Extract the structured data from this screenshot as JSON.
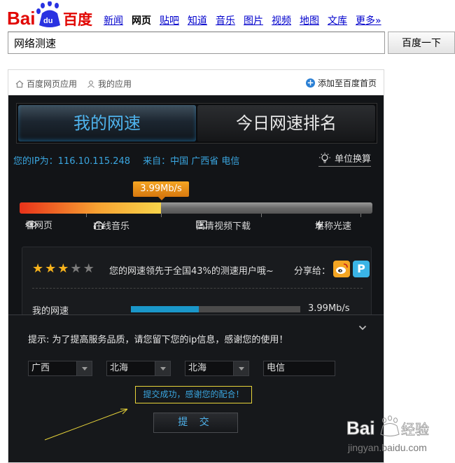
{
  "logo": {
    "bai": "Bai",
    "du": "du",
    "cn": "百度"
  },
  "nav": {
    "items": [
      "新闻",
      "网页",
      "贴吧",
      "知道",
      "音乐",
      "图片",
      "视频",
      "地图",
      "文库"
    ],
    "active_index": 1,
    "more": "更多»"
  },
  "search": {
    "value": "网络测速",
    "button": "百度一下"
  },
  "app": {
    "crumb_home": "百度网页应用",
    "crumb_mine": "我的应用",
    "add_home": "添加至百度首页",
    "tab_my": "我的网速",
    "tab_rank": "今日网速排名",
    "ip_label": "您的IP为：116.10.115.248",
    "from_label": "来自：中国 广西省 电信",
    "unit_switch": "单位换算",
    "speed_tip": "3.99Mb/s",
    "speed_fraction": 0.4,
    "scale_labels": [
      "看网页",
      "在线音乐",
      "高清视频下载",
      "堪称光速"
    ],
    "stars_on": 3,
    "stars_total": 5,
    "rank_text": "您的网速领先于全国43%的测速用户哦~",
    "share_label": "分享给：",
    "my_speed_label": "我的网速",
    "my_speed_fraction": 0.4,
    "my_speed_value": "3.99Mb/s"
  },
  "form": {
    "prompt": "提示: 为了提高服务品质，请您留下您的ip信息，感谢您的使用！",
    "province": "广西",
    "city": "北海",
    "district": "北海",
    "isp": "电信",
    "success": "提交成功，感谢您的配合！",
    "submit": "提 交"
  },
  "watermark": {
    "brand": "Bai",
    "brand2": "经验",
    "url": "jingyan.baidu.com"
  },
  "colors": {
    "baidu_red": "#e10602",
    "baidu_blue": "#2932e1",
    "accent_blue": "#3aa6e0",
    "tip_orange": "#e88a18"
  }
}
